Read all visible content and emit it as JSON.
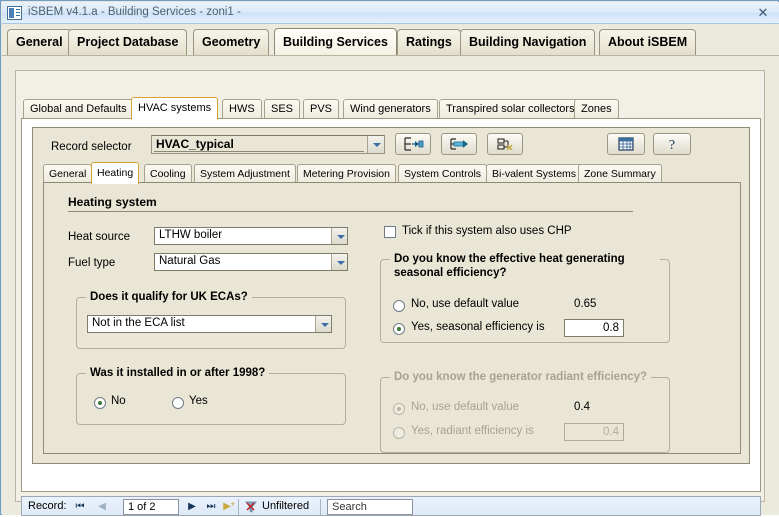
{
  "window": {
    "title": "iSBEM v4.1.a - Building Services - zoni1 -",
    "icon": "app-window-icon",
    "close_label": "✕"
  },
  "main_tabs": [
    {
      "label": "General",
      "active": false
    },
    {
      "label": "Project Database",
      "active": false
    },
    {
      "label": "Geometry",
      "active": false
    },
    {
      "label": "Building Services",
      "active": true
    },
    {
      "label": "Ratings",
      "active": false
    },
    {
      "label": "Building Navigation",
      "active": false
    },
    {
      "label": "About iSBEM",
      "active": false
    }
  ],
  "sub_tabs": [
    {
      "label": "Global and Defaults",
      "active": false
    },
    {
      "label": "HVAC systems",
      "active": true
    },
    {
      "label": "HWS",
      "active": false
    },
    {
      "label": "SES",
      "active": false
    },
    {
      "label": "PVS",
      "active": false
    },
    {
      "label": "Wind generators",
      "active": false
    },
    {
      "label": "Transpired solar collectors",
      "active": false
    },
    {
      "label": "Zones",
      "active": false
    }
  ],
  "record_selector": {
    "label": "Record selector",
    "value": "HVAC_typical",
    "buttons": [
      {
        "name": "add-record-button",
        "icon": "add-record-icon"
      },
      {
        "name": "duplicate-record-button",
        "icon": "arrow-right-icon"
      },
      {
        "name": "delete-record-button",
        "icon": "delete-record-icon"
      }
    ],
    "right_buttons": [
      {
        "name": "table-view-button",
        "icon": "grid-icon"
      },
      {
        "name": "help-button",
        "icon": "question-mark-icon"
      }
    ]
  },
  "inner_tabs": [
    {
      "label": "General",
      "active": false
    },
    {
      "label": "Heating",
      "active": true
    },
    {
      "label": "Cooling",
      "active": false
    },
    {
      "label": "System Adjustment",
      "active": false
    },
    {
      "label": "Metering Provision",
      "active": false
    },
    {
      "label": "System Controls",
      "active": false
    },
    {
      "label": "Bi-valent Systems",
      "active": false
    },
    {
      "label": "Zone Summary",
      "active": false
    }
  ],
  "heating": {
    "section_title": "Heating system",
    "heat_source_label": "Heat source",
    "heat_source_value": "LTHW boiler",
    "fuel_type_label": "Fuel type",
    "fuel_type_value": "Natural Gas",
    "chp_checkbox_label": "Tick if this system also uses CHP",
    "chp_checked": false
  },
  "eca_group": {
    "title": "Does it qualify for UK ECAs?",
    "value": "Not in the ECA list"
  },
  "installed_group": {
    "title": "Was it installed in or after 1998?",
    "options": [
      {
        "label": "No",
        "checked": true
      },
      {
        "label": "Yes",
        "checked": false
      }
    ]
  },
  "seasonal_efficiency_group": {
    "title_line1": "Do you know the effective heat generating",
    "title_line2": "seasonal efficiency?",
    "option_default_label": "No, use default value",
    "option_default_value": "0.65",
    "option_default_checked": false,
    "option_custom_label": "Yes, seasonal efficiency is",
    "option_custom_value": "0.8",
    "option_custom_checked": true
  },
  "radiant_efficiency_group": {
    "title": "Do you know the generator radiant efficiency?",
    "disabled": true,
    "option_default_label": "No, use default value",
    "option_default_value": "0.4",
    "option_default_checked": true,
    "option_custom_label": "Yes, radiant efficiency is",
    "option_custom_value": "0.4",
    "option_custom_checked": false
  },
  "record_nav": {
    "label": "Record:",
    "first_icon": "⏮",
    "prev_icon": "◀",
    "position": "1 of 2",
    "next_icon": "▶",
    "last_icon": "⏭",
    "new_icon": "▶*",
    "filter_status": "Unfiltered",
    "search_placeholder": "Search"
  },
  "colors": {
    "titlebar": "#cfe2f5",
    "panel": "#e9e6d5",
    "active_tab_accent": "#d6a132",
    "radio_dot": "#3a7a3a",
    "combo_arrow": "#3a6ea8"
  }
}
